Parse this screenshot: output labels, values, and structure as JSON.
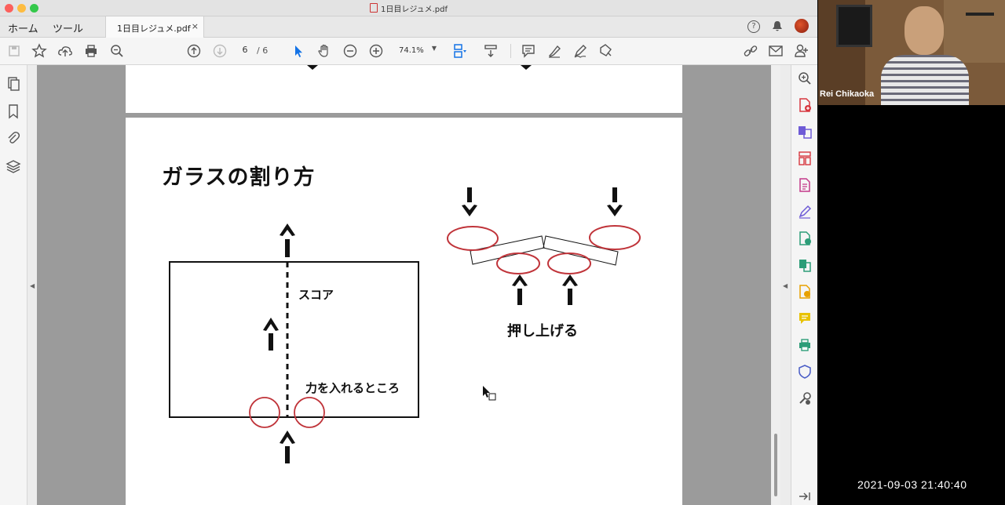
{
  "window": {
    "title": "1日目レジュメ.pdf"
  },
  "tabs": {
    "home": "ホーム",
    "tools": "ツール",
    "document": "1日目レジュメ.pdf",
    "close": "×"
  },
  "toolbar": {
    "page_current": "6",
    "page_total": "/ 6",
    "zoom": "74.1%"
  },
  "page": {
    "heading": "ガラスの割り方",
    "score_label": "スコア",
    "force_label": "力を入れるところ",
    "push_label": "押し上げる"
  },
  "video": {
    "participant_name": "Rei Chikaoka",
    "timestamp": "2021-09-03 21:40:40"
  },
  "colors": {
    "accent_blue": "#1473e6",
    "circle_red": "#c0343a",
    "brand_red": "#d7373f",
    "panel_green": "#2d9d78"
  },
  "icons": {
    "toolbar": [
      "save-icon",
      "bookmark-star-icon",
      "upload-icon",
      "print-icon",
      "search-icon",
      "page-up-icon",
      "page-down-icon",
      "select-arrow-icon",
      "hand-icon",
      "zoom-out-icon",
      "zoom-in-icon",
      "fit-page-icon",
      "scroll-mode-icon",
      "comment-icon",
      "highlighter-icon",
      "sign-icon",
      "stamp-icon",
      "share-link-icon",
      "email-icon",
      "add-user-icon"
    ],
    "left_panel": [
      "page-thumbnails-icon",
      "bookmarks-icon",
      "attachments-icon",
      "layers-icon"
    ],
    "right_panel": [
      "search-icon",
      "create-pdf-icon",
      "combine-files-icon",
      "organize-pages-icon",
      "export-pdf-icon",
      "edit-pdf-icon",
      "request-signature-icon",
      "compress-pdf-icon",
      "scan-icon",
      "comment-tool-icon",
      "print-production-icon",
      "protect-icon",
      "more-tools-icon"
    ]
  }
}
